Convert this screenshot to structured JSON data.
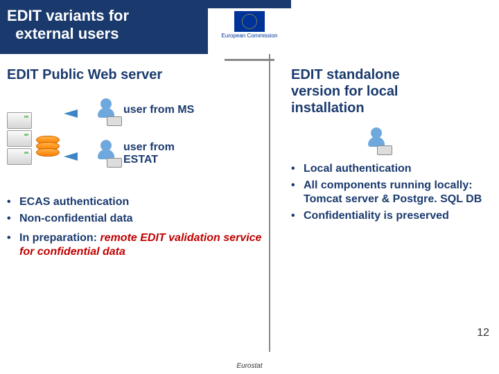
{
  "header": {
    "title_line1": "EDIT variants for",
    "title_line2": "external users",
    "logo_text": "European Commission"
  },
  "left": {
    "heading": "EDIT Public Web server",
    "user_ms": "user from MS",
    "user_estat_l1": "user from",
    "user_estat_l2": "ESTAT",
    "bullets": [
      "ECAS authentication",
      "Non-confidential data"
    ],
    "prep_prefix": "In preparation: ",
    "prep_em": "remote EDIT validation service for confidential data"
  },
  "right": {
    "heading_l1": "EDIT standalone",
    "heading_l2": "version for local",
    "heading_l3": "installation",
    "bullets": [
      "Local authentication",
      "All components running locally: Tomcat server & Postgre. SQL DB",
      "Confidentiality is preserved"
    ]
  },
  "footer": "Eurostat",
  "page_number": "12"
}
